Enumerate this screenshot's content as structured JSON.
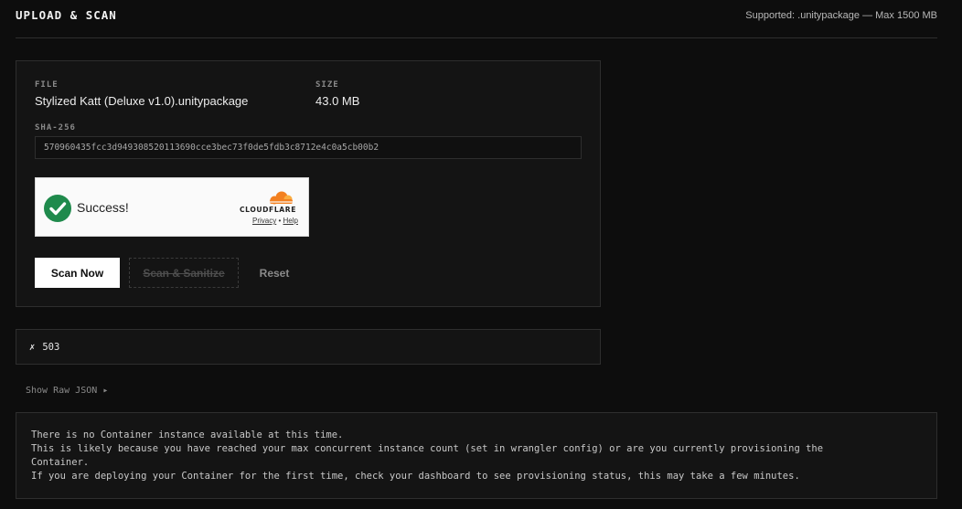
{
  "header": {
    "title": "UPLOAD & SCAN",
    "supported": "Supported: .unitypackage — Max 1500 MB"
  },
  "file": {
    "file_label": "FILE",
    "file_name": "Stylized Katt (Deluxe v1.0).unitypackage",
    "size_label": "SIZE",
    "size_value": "43.0 MB",
    "hash_label": "SHA-256",
    "hash_value": "570960435fcc3d949308520113690cce3bec73f0de5fdb3c8712e4c0a5cb00b2"
  },
  "turnstile": {
    "status": "Success!",
    "brand": "CLOUDFLARE",
    "privacy": "Privacy",
    "separator": "•",
    "help": "Help",
    "check_color": "#1f8a4c",
    "cloud_color": "#f38020"
  },
  "actions": {
    "scan_now": "Scan Now",
    "scan_sanitize": "Scan & Sanitize",
    "reset": "Reset"
  },
  "error": {
    "icon": "✗",
    "code": "503"
  },
  "raw": {
    "toggle_label": "Show Raw JSON",
    "toggle_icon": "▸",
    "lines": [
      "There is no Container instance available at this time.",
      "This is likely because you have reached your max concurrent instance count (set in wrangler config) or are you currently provisioning the",
      "Container.",
      "If you are deploying your Container for the first time, check your dashboard to see provisioning status, this may take a few minutes."
    ]
  }
}
